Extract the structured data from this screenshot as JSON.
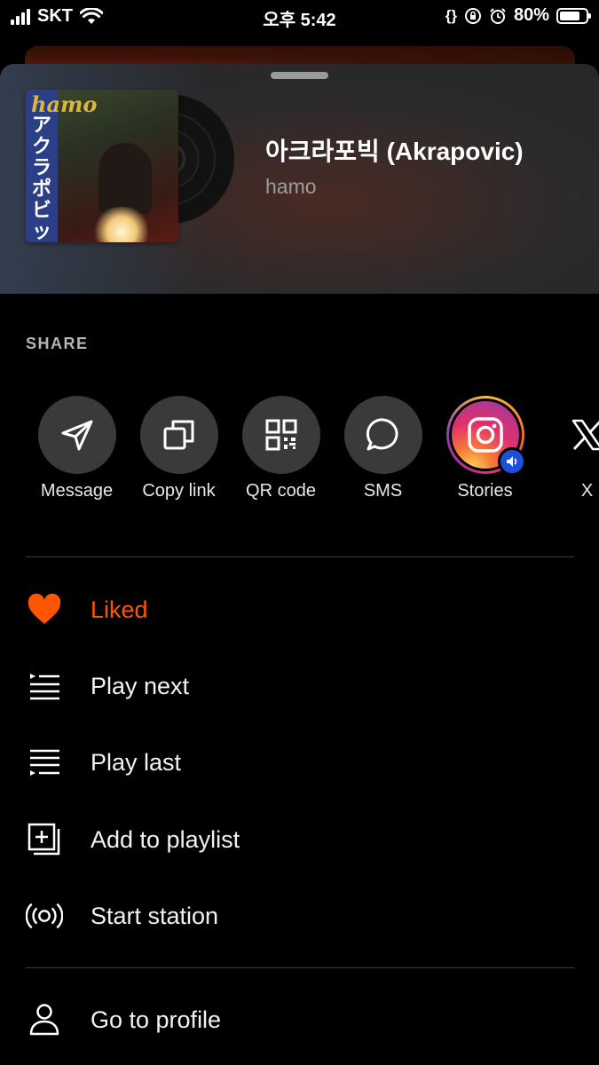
{
  "status_bar": {
    "carrier": "SKT",
    "time": "오후 5:42",
    "battery_text": "80%",
    "battery_level": 0.8,
    "extra_icons": [
      "code-braces-icon",
      "rotation-lock-icon",
      "alarm-icon"
    ]
  },
  "track": {
    "title": "아크라포빅 (Akrapovic)",
    "artist": "hamo",
    "cover_title": "hamo",
    "cover_text": "アクラポビッチ"
  },
  "share": {
    "label": "SHARE",
    "options": [
      {
        "label": "Message",
        "icon": "send-icon"
      },
      {
        "label": "Copy link",
        "icon": "copy-icon"
      },
      {
        "label": "QR code",
        "icon": "qr-code-icon"
      },
      {
        "label": "SMS",
        "icon": "chat-bubble-icon"
      },
      {
        "label": "Stories",
        "icon": "instagram-icon"
      },
      {
        "label": "X",
        "icon": "x-logo-icon"
      }
    ]
  },
  "menu": {
    "items": [
      {
        "label": "Liked",
        "icon": "heart-icon",
        "active": true
      },
      {
        "label": "Play next",
        "icon": "play-next-icon"
      },
      {
        "label": "Play last",
        "icon": "play-last-icon"
      },
      {
        "label": "Add to playlist",
        "icon": "add-to-playlist-icon"
      },
      {
        "label": "Start station",
        "icon": "station-icon"
      },
      {
        "label": "Go to profile",
        "icon": "profile-icon"
      }
    ]
  },
  "colors": {
    "accent": "#ff5500",
    "background": "#000000",
    "icon_circle": "#3a3a3a",
    "muted_text": "#9d9d9d"
  }
}
